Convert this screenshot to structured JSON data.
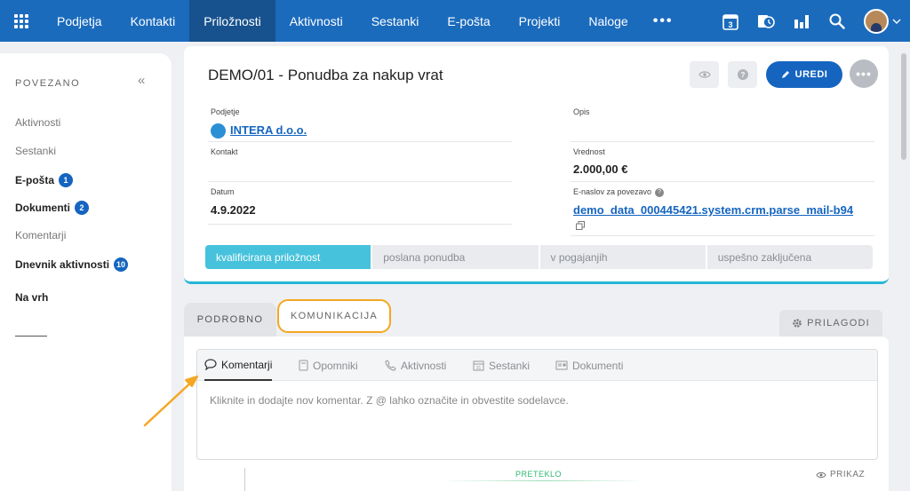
{
  "nav": {
    "items": [
      "Podjetja",
      "Kontakti",
      "Priložnosti",
      "Aktivnosti",
      "Sestanki",
      "E-pošta",
      "Projekti",
      "Naloge"
    ],
    "active_index": 2,
    "more": "•••",
    "calendar_day": "3",
    "icons": [
      "apps-grid-icon",
      "calendar-icon",
      "time-icon",
      "chart-icon",
      "search-icon",
      "avatar",
      "chevron-down-icon"
    ],
    "color": "#1b6bbd"
  },
  "left": {
    "title": "POVEZANO",
    "collapse": "«",
    "items": [
      {
        "label": "Aktivnosti",
        "bold": false
      },
      {
        "label": "Sestanki",
        "bold": false
      },
      {
        "label": "E-pošta",
        "bold": true,
        "badge": "1"
      },
      {
        "label": "Dokumenti",
        "bold": true,
        "badge": "2"
      },
      {
        "label": "Komentarji",
        "bold": false
      },
      {
        "label": "Dnevnik aktivnosti",
        "bold": true,
        "badge": "10"
      }
    ],
    "top_link": "Na vrh"
  },
  "record": {
    "title": "DEMO/01 - Ponudba za nakup vrat",
    "edit_label": "UREDI",
    "fields": {
      "company_label": "Podjetje",
      "company_value": "INTERA d.o.o.",
      "contact_label": "Kontakt",
      "date_label": "Datum",
      "date_value": "4.9.2022",
      "description_label": "Opis",
      "value_label": "Vrednost",
      "value_value": "2.000,00 €",
      "email_label": "E-naslov za povezavo",
      "email_value": "demo_data_000445421.system.crm.parse_mail-b94"
    },
    "stages": [
      "kvalificirana priložnost",
      "poslana ponudba",
      "v pogajanjih",
      "uspešno zaključena"
    ],
    "active_stage": 0,
    "accent": "#46c2dc"
  },
  "tabs": {
    "podrobno": "PODROBNO",
    "komunikacija": "KOMUNIKACIJA",
    "prilagodi": "PRILAGODI",
    "highlight_color": "#f6a623"
  },
  "communication": {
    "subtabs": [
      "Komentarji",
      "Opomniki",
      "Aktivnosti",
      "Sestanki",
      "Dokumenti"
    ],
    "subtab_icons": [
      "comment-icon",
      "reminder-icon",
      "phone-icon",
      "calendar-icon",
      "document-icon"
    ],
    "active_subtab": 0,
    "comment_placeholder": "Kliknite in dodajte nov komentar. Z @ lahko označite in obvestite sodelavce.",
    "timeline_label": "PRETEKLO",
    "view_label": "PRIKAZ"
  }
}
